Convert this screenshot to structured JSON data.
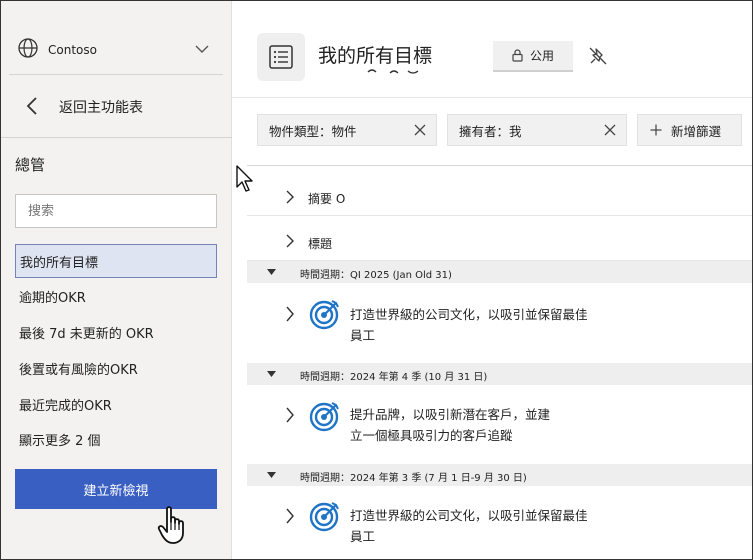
{
  "sidebar": {
    "tenant": "Contoso",
    "back_label": "返回主功能表",
    "section_title": "總管",
    "search_placeholder": "搜索",
    "items": [
      {
        "label": "我的所有目標",
        "active": true
      },
      {
        "label": "逾期的OKR"
      },
      {
        "label": "最後 7d 未更新的 OKR"
      },
      {
        "label": "後置或有風險的OKR"
      },
      {
        "label": "最近完成的OKR"
      },
      {
        "label": "顯示更多 2 個"
      }
    ],
    "create_label": "建立新檢視"
  },
  "header": {
    "title": "我的所有目標",
    "visibility": "公用"
  },
  "filters": {
    "type_chip": "物件類型：物件",
    "owner_chip": "擁有者：我",
    "add_filter": "新增篩選"
  },
  "columns": {
    "summary": "摘要 O",
    "title": "標題"
  },
  "groups": [
    {
      "label": "時間週期：QI 2025 (Jan Old 31)",
      "objectives": [
        "打造世界級的公司文化，以吸引並保留最佳員工"
      ]
    },
    {
      "label": "時間週期：2024 年第 4 季 (10 月 31 日)",
      "objectives": [
        "提升品牌，以吸引新潛在客戶，並建立一個極具吸引力的客戶追蹤"
      ]
    },
    {
      "label": "時間週期：2024 年第 3 季 (7 月 1 日-9 月 30 日)",
      "objectives": [
        "打造世界級的公司文化，以吸引並保留最佳員工"
      ]
    }
  ],
  "colors": {
    "accent": "#3a5fc3",
    "target": "#1f74c8"
  }
}
